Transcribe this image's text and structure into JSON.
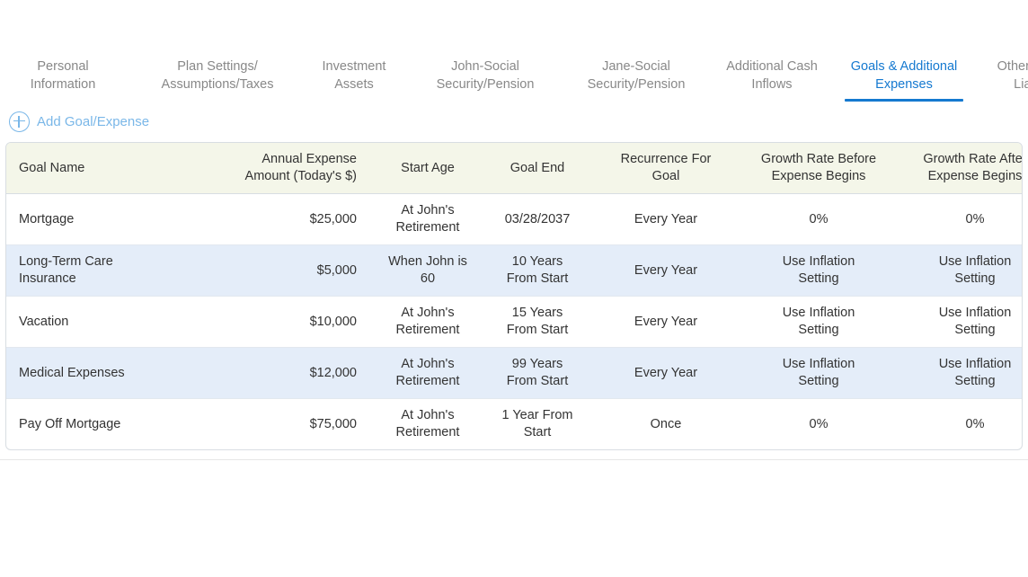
{
  "tabs": [
    {
      "label": "Personal\nInformation",
      "active": false
    },
    {
      "label": "Plan Settings/\nAssumptions/Taxes",
      "active": false
    },
    {
      "label": "Investment\nAssets",
      "active": false
    },
    {
      "label": "John-Social\nSecurity/Pension",
      "active": false
    },
    {
      "label": "Jane-Social\nSecurity/Pension",
      "active": false
    },
    {
      "label": "Additional Cash\nInflows",
      "active": false
    },
    {
      "label": "Goals & Additional\nExpenses",
      "active": true
    },
    {
      "label": "Other Assets &\nLiabilities",
      "active": false
    }
  ],
  "add_action": {
    "label": "Add Goal/Expense",
    "icon": "plus-circle-icon"
  },
  "table": {
    "columns": [
      "Goal Name",
      "Annual Expense\nAmount (Today's $)",
      "Start Age",
      "Goal End",
      "Recurrence For\nGoal",
      "Growth Rate Before\nExpense Begins",
      "Growth Rate After\nExpense Begins",
      "",
      ""
    ],
    "row_icons": {
      "edit": "pencil-icon",
      "delete": "trash-icon"
    },
    "rows": [
      {
        "goal_name": "Mortgage",
        "amount": "$25,000",
        "start_age": "At John's\nRetirement",
        "goal_end": "03/28/2037",
        "recurrence": "Every Year",
        "growth_before": "0%",
        "growth_after": "0%"
      },
      {
        "goal_name": "Long-Term Care\nInsurance",
        "amount": "$5,000",
        "start_age": "When John is\n60",
        "goal_end": "10 Years\nFrom Start",
        "recurrence": "Every Year",
        "growth_before": "Use Inflation\nSetting",
        "growth_after": "Use Inflation\nSetting"
      },
      {
        "goal_name": "Vacation",
        "amount": "$10,000",
        "start_age": "At John's\nRetirement",
        "goal_end": "15 Years\nFrom Start",
        "recurrence": "Every Year",
        "growth_before": "Use Inflation\nSetting",
        "growth_after": "Use Inflation\nSetting"
      },
      {
        "goal_name": "Medical Expenses",
        "amount": "$12,000",
        "start_age": "At John's\nRetirement",
        "goal_end": "99 Years\nFrom Start",
        "recurrence": "Every Year",
        "growth_before": "Use Inflation\nSetting",
        "growth_after": "Use Inflation\nSetting"
      },
      {
        "goal_name": "Pay Off Mortgage",
        "amount": "$75,000",
        "start_age": "At John's\nRetirement",
        "goal_end": "1 Year From\nStart",
        "recurrence": "Once",
        "growth_before": "0%",
        "growth_after": "0%"
      }
    ]
  },
  "colors": {
    "accent": "#1579d0",
    "tab_inactive": "#888888",
    "add_link": "#7ab7e8",
    "header_bg": "#f4f6e9",
    "alt_row_bg": "#e4edf9",
    "border": "#d8dde2",
    "text": "#333333"
  }
}
